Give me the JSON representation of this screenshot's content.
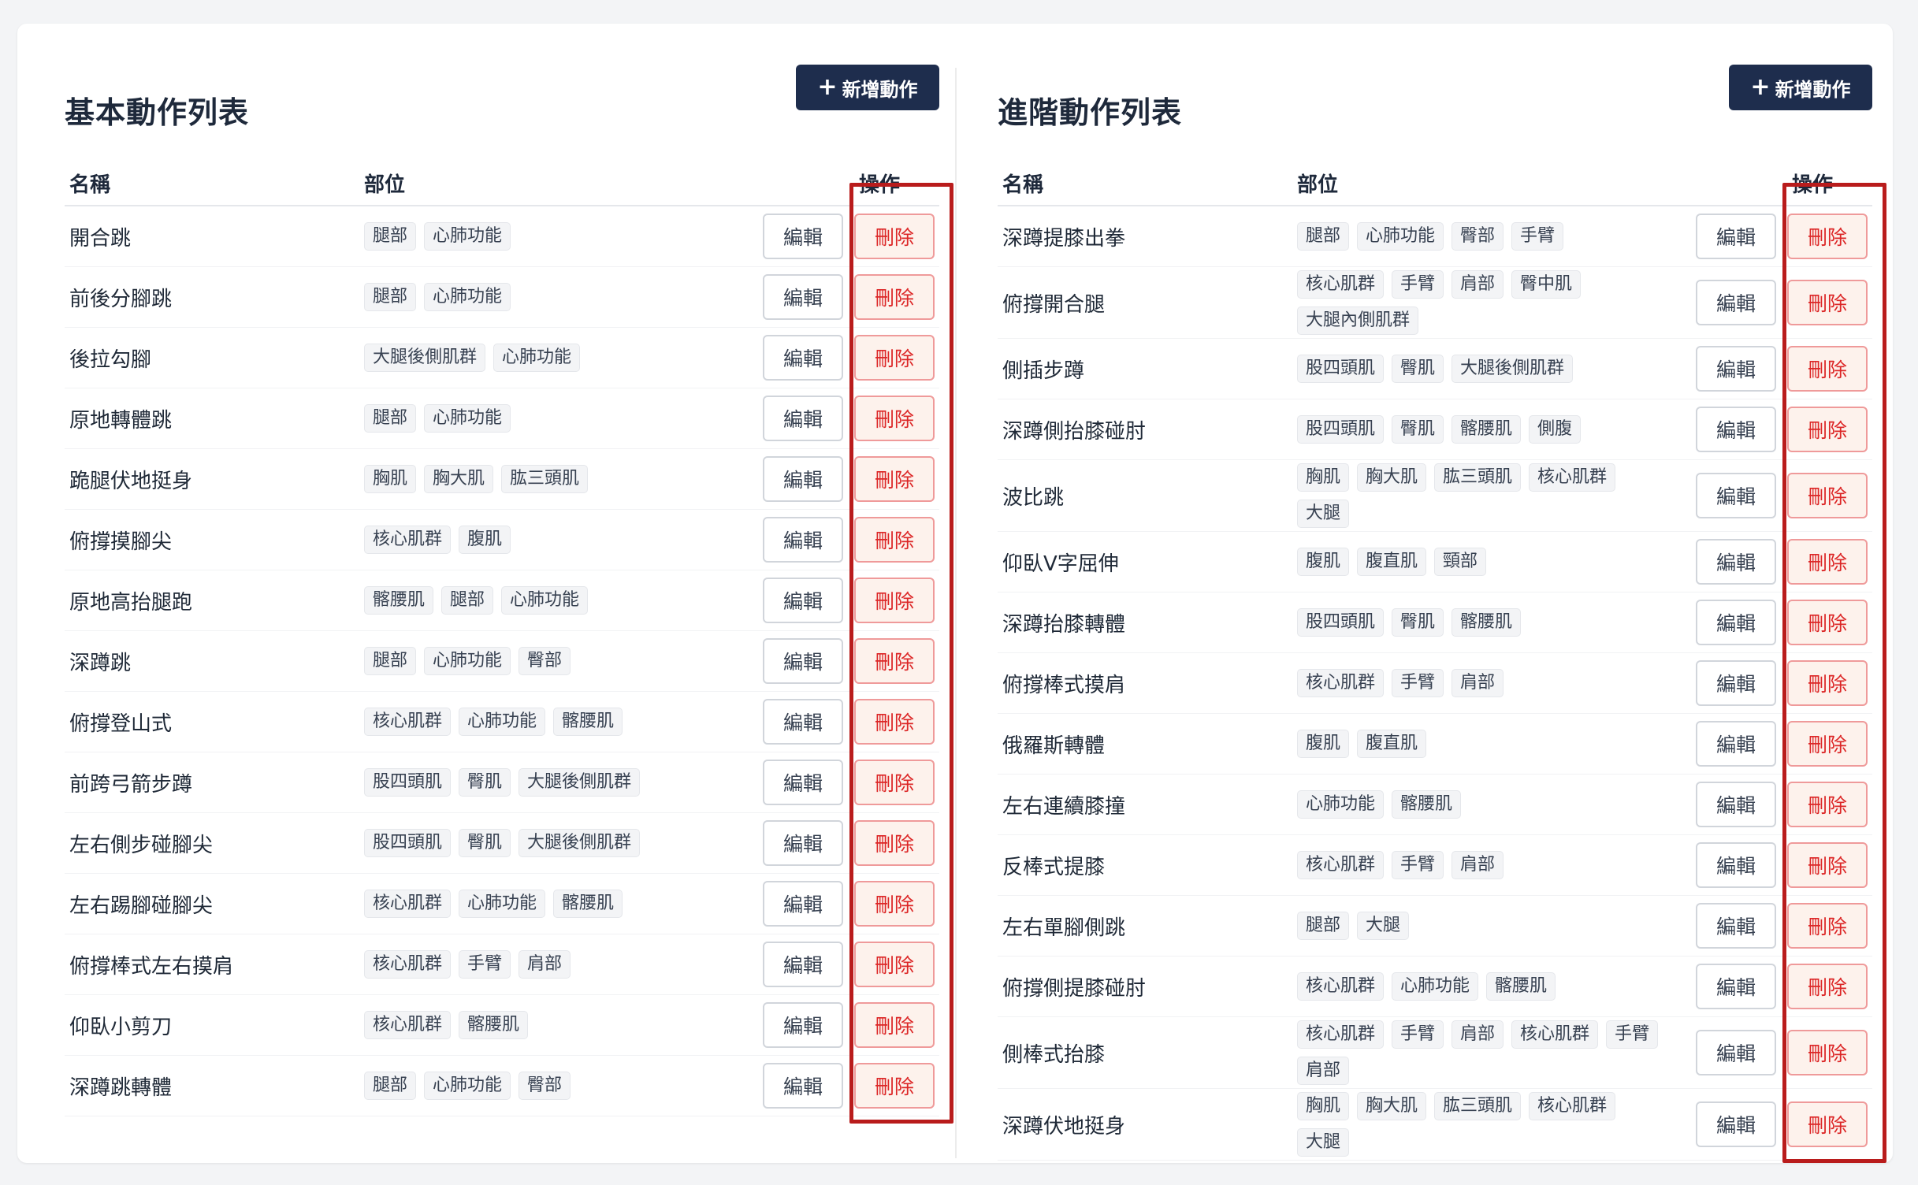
{
  "panels": [
    {
      "id": "basic",
      "title": "基本動作列表",
      "add_label": "新增動作",
      "headers": {
        "name": "名稱",
        "part": "部位",
        "action": "操作"
      },
      "edit_label": "編輯",
      "delete_label": "刪除",
      "rows": [
        {
          "name": "開合跳",
          "tags": [
            "腿部",
            "心肺功能"
          ]
        },
        {
          "name": "前後分腳跳",
          "tags": [
            "腿部",
            "心肺功能"
          ]
        },
        {
          "name": "後拉勾腳",
          "tags": [
            "大腿後側肌群",
            "心肺功能"
          ]
        },
        {
          "name": "原地轉體跳",
          "tags": [
            "腿部",
            "心肺功能"
          ]
        },
        {
          "name": "跪腿伏地挺身",
          "tags": [
            "胸肌",
            "胸大肌",
            "肱三頭肌"
          ]
        },
        {
          "name": "俯撐摸腳尖",
          "tags": [
            "核心肌群",
            "腹肌"
          ]
        },
        {
          "name": "原地高抬腿跑",
          "tags": [
            "髂腰肌",
            "腿部",
            "心肺功能"
          ]
        },
        {
          "name": "深蹲跳",
          "tags": [
            "腿部",
            "心肺功能",
            "臀部"
          ]
        },
        {
          "name": "俯撐登山式",
          "tags": [
            "核心肌群",
            "心肺功能",
            "髂腰肌"
          ]
        },
        {
          "name": "前跨弓箭步蹲",
          "tags": [
            "股四頭肌",
            "臀肌",
            "大腿後側肌群"
          ]
        },
        {
          "name": "左右側步碰腳尖",
          "tags": [
            "股四頭肌",
            "臀肌",
            "大腿後側肌群"
          ]
        },
        {
          "name": "左右踢腳碰腳尖",
          "tags": [
            "核心肌群",
            "心肺功能",
            "髂腰肌"
          ]
        },
        {
          "name": "俯撐棒式左右摸肩",
          "tags": [
            "核心肌群",
            "手臂",
            "肩部"
          ]
        },
        {
          "name": "仰臥小剪刀",
          "tags": [
            "核心肌群",
            "髂腰肌"
          ]
        },
        {
          "name": "深蹲跳轉體",
          "tags": [
            "腿部",
            "心肺功能",
            "臀部"
          ]
        }
      ]
    },
    {
      "id": "advanced",
      "title": "進階動作列表",
      "add_label": "新增動作",
      "headers": {
        "name": "名稱",
        "part": "部位",
        "action": "操作"
      },
      "edit_label": "編輯",
      "delete_label": "刪除",
      "rows": [
        {
          "name": "深蹲提膝出拳",
          "tags": [
            "腿部",
            "心肺功能",
            "臀部",
            "手臂"
          ]
        },
        {
          "name": "俯撐開合腿",
          "tags": [
            "核心肌群",
            "手臂",
            "肩部",
            "臀中肌",
            "大腿內側肌群"
          ]
        },
        {
          "name": "側插步蹲",
          "tags": [
            "股四頭肌",
            "臀肌",
            "大腿後側肌群"
          ]
        },
        {
          "name": "深蹲側抬膝碰肘",
          "tags": [
            "股四頭肌",
            "臀肌",
            "髂腰肌",
            "側腹"
          ]
        },
        {
          "name": "波比跳",
          "tags": [
            "胸肌",
            "胸大肌",
            "肱三頭肌",
            "核心肌群",
            "大腿"
          ]
        },
        {
          "name": "仰臥V字屈伸",
          "tags": [
            "腹肌",
            "腹直肌",
            "頸部"
          ]
        },
        {
          "name": "深蹲抬膝轉體",
          "tags": [
            "股四頭肌",
            "臀肌",
            "髂腰肌"
          ]
        },
        {
          "name": "俯撐棒式摸肩",
          "tags": [
            "核心肌群",
            "手臂",
            "肩部"
          ]
        },
        {
          "name": "俄羅斯轉體",
          "tags": [
            "腹肌",
            "腹直肌"
          ]
        },
        {
          "name": "左右連續膝撞",
          "tags": [
            "心肺功能",
            "髂腰肌"
          ]
        },
        {
          "name": "反棒式提膝",
          "tags": [
            "核心肌群",
            "手臂",
            "肩部"
          ]
        },
        {
          "name": "左右單腳側跳",
          "tags": [
            "腿部",
            "大腿"
          ]
        },
        {
          "name": "俯撐側提膝碰肘",
          "tags": [
            "核心肌群",
            "心肺功能",
            "髂腰肌"
          ]
        },
        {
          "name": "側棒式抬膝",
          "tags": [
            "核心肌群",
            "手臂",
            "肩部",
            "核心肌群",
            "手臂",
            "肩部"
          ]
        },
        {
          "name": "深蹲伏地挺身",
          "tags": [
            "胸肌",
            "胸大肌",
            "肱三頭肌",
            "核心肌群",
            "大腿"
          ]
        }
      ]
    }
  ]
}
